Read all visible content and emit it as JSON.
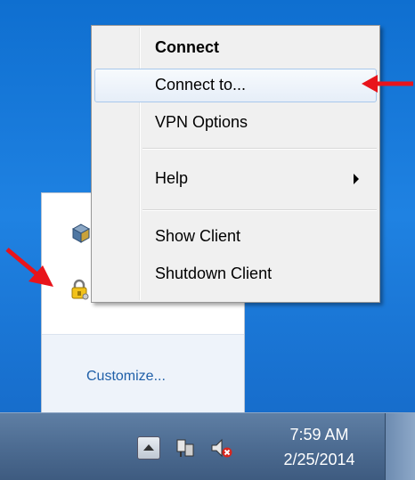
{
  "context_menu": {
    "items": [
      {
        "label": "Connect",
        "bold": true
      },
      {
        "label": "Connect to...",
        "highlighted": true
      },
      {
        "label": "VPN Options"
      },
      {
        "label": "Help",
        "has_submenu": true
      },
      {
        "label": "Show Client"
      },
      {
        "label": "Shutdown Client"
      }
    ]
  },
  "tray_overflow": {
    "icons": [
      "virtualbox-icon",
      "vpn-lock-icon",
      "gear-icon"
    ],
    "customize_label": "Customize..."
  },
  "taskbar": {
    "clock_time": "7:59 AM",
    "clock_date": "2/25/2014",
    "icons": [
      "show-hidden-icons-icon",
      "network-icon",
      "volume-muted-icon"
    ]
  },
  "colors": {
    "annotation_arrow": "#e8141b",
    "menu_highlight_border": "#a8c8ec",
    "customize_link": "#1f5fa8"
  }
}
